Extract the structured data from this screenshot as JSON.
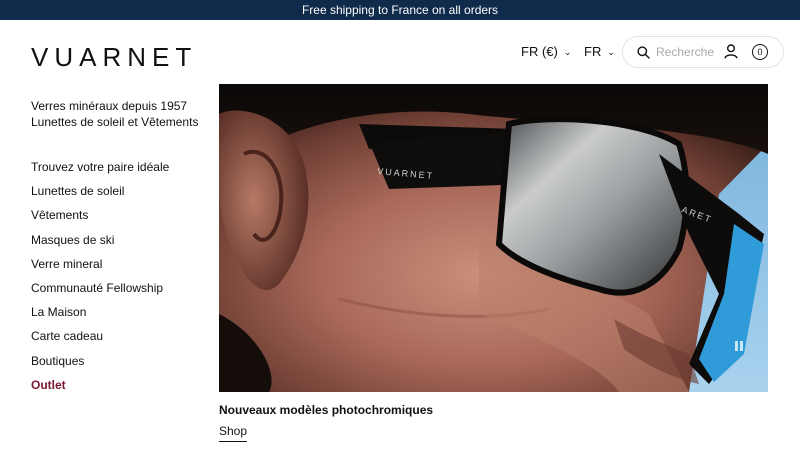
{
  "announcement": "Free shipping to France on all orders",
  "brand": {
    "logo_text": "VUARNET"
  },
  "header": {
    "currency": "FR (€)",
    "language": "FR",
    "search_placeholder": "Recherche",
    "cart_count": "0",
    "icons": {
      "search": "search-icon",
      "account": "user-icon",
      "cart": "cart-icon"
    }
  },
  "tagline": {
    "line1": "Verres minéraux depuis 1957",
    "line2": "Lunettes de soleil et Vêtements"
  },
  "nav": {
    "items": [
      {
        "label": "Trouvez votre paire idéale"
      },
      {
        "label": "Lunettes de soleil"
      },
      {
        "label": "Vêtements"
      },
      {
        "label": "Masques de ski"
      },
      {
        "label": "Verre mineral"
      },
      {
        "label": "Communauté Fellowship"
      },
      {
        "label": "La Maison"
      },
      {
        "label": "Carte cadeau"
      },
      {
        "label": "Boutiques"
      },
      {
        "label": "Outlet"
      }
    ],
    "outlet_color": "#7a1730"
  },
  "hero": {
    "caption": "Nouveaux modèles photochromiques",
    "cta": "Shop",
    "frame_print": "VUARNET",
    "temple_print": "ARET",
    "media_control": "pause-icon"
  },
  "colors": {
    "announcement_bg": "#0f2a4a",
    "text": "#111111"
  }
}
